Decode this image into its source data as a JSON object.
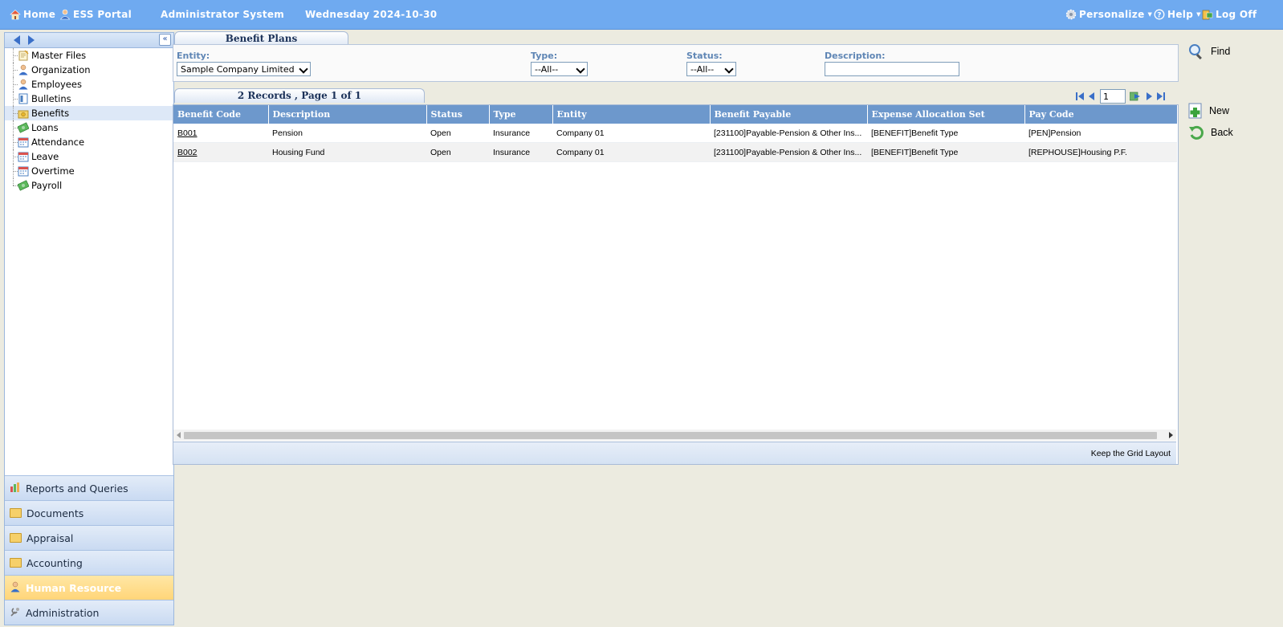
{
  "topbar": {
    "home": "Home",
    "ess_portal": "ESS Portal",
    "system": "Administrator System",
    "date": "Wednesday 2024-10-30",
    "personalize": "Personalize",
    "help": "Help",
    "logoff": "Log Off"
  },
  "sidebar": {
    "tree": [
      {
        "label": "Master Files",
        "icon": "note-icon"
      },
      {
        "label": "Organization",
        "icon": "person-icon"
      },
      {
        "label": "Employees",
        "icon": "person-icon"
      },
      {
        "label": "Bulletins",
        "icon": "bulletin-icon"
      },
      {
        "label": "Benefits",
        "icon": "benefits-icon"
      },
      {
        "label": "Loans",
        "icon": "money-icon"
      },
      {
        "label": "Attendance",
        "icon": "calendar-icon"
      },
      {
        "label": "Leave",
        "icon": "calendar-icon"
      },
      {
        "label": "Overtime",
        "icon": "calendar-icon"
      },
      {
        "label": "Payroll",
        "icon": "money-icon"
      }
    ],
    "selected": "Benefits",
    "accordion": [
      {
        "label": "Reports and Queries"
      },
      {
        "label": "Documents"
      },
      {
        "label": "Appraisal"
      },
      {
        "label": "Accounting"
      },
      {
        "label": "Human Resource"
      },
      {
        "label": "Administration"
      }
    ]
  },
  "main": {
    "tab_title": "Benefit Plans",
    "filters": {
      "entity_label": "Entity:",
      "entity_value": "Sample Company Limited",
      "type_label": "Type:",
      "type_value": "--All--",
      "status_label": "Status:",
      "status_value": "--All--",
      "description_label": "Description:",
      "description_value": ""
    },
    "records_title": "2 Records , Page 1 of 1",
    "page_input": "1",
    "columns": [
      "Benefit Code",
      "Description",
      "Status",
      "Type",
      "Entity",
      "Benefit Payable",
      "Expense Allocation Set",
      "Pay Code"
    ],
    "rows": [
      [
        "B001",
        "Pension",
        "Open",
        "Insurance",
        "Company 01",
        "[231100]Payable-Pension & Other Ins...",
        "[BENEFIT]Benefit Type",
        "[PEN]Pension"
      ],
      [
        "B002",
        "Housing Fund",
        "Open",
        "Insurance",
        "Company 01",
        "[231100]Payable-Pension & Other Ins...",
        "[BENEFIT]Benefit Type",
        "[REPHOUSE]Housing P.F."
      ]
    ],
    "footer_text": "Keep the Grid Layout"
  },
  "actions": {
    "find": "Find",
    "new": "New",
    "back": "Back"
  }
}
